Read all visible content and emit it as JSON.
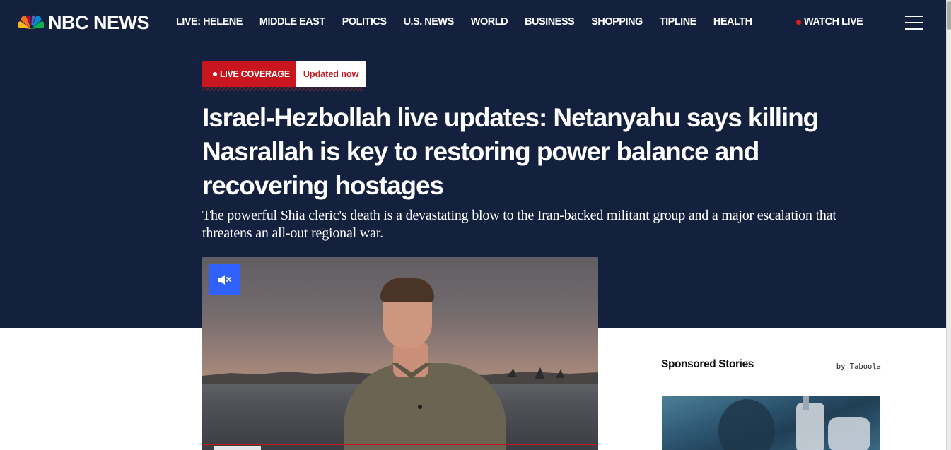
{
  "brand": {
    "name": "NBC NEWS",
    "peacock_colors": [
      "#fcb711",
      "#f37021",
      "#cc004c",
      "#6460aa",
      "#0089d0",
      "#0db14b"
    ]
  },
  "nav": {
    "items": [
      {
        "label": "LIVE: HELENE"
      },
      {
        "label": "MIDDLE EAST"
      },
      {
        "label": "POLITICS"
      },
      {
        "label": "U.S. NEWS"
      },
      {
        "label": "WORLD"
      },
      {
        "label": "BUSINESS"
      },
      {
        "label": "SHOPPING"
      },
      {
        "label": "TIPLINE"
      },
      {
        "label": "HEALTH"
      }
    ],
    "watch_live": "WATCH LIVE",
    "menu_icon": "hamburger-menu-icon"
  },
  "article": {
    "live_label": "LIVE COVERAGE",
    "updated_label": "Updated now",
    "headline": "Israel-Hezbollah live updates: Netanyahu says killing Nasrallah is key to restoring power balance and recovering hostages",
    "dek": "The powerful Shia cleric's death is a devastating blow to the Iran-backed militant group and a major escalation that threatens an all-out regional war.",
    "video": {
      "mute_icon": "muted-speaker-icon"
    }
  },
  "sponsored": {
    "title": "Sponsored Stories",
    "by": "by Taboola"
  },
  "colors": {
    "hero_bg": "#13213e",
    "accent_red": "#c8151e",
    "mute_blue": "#3061ff"
  }
}
